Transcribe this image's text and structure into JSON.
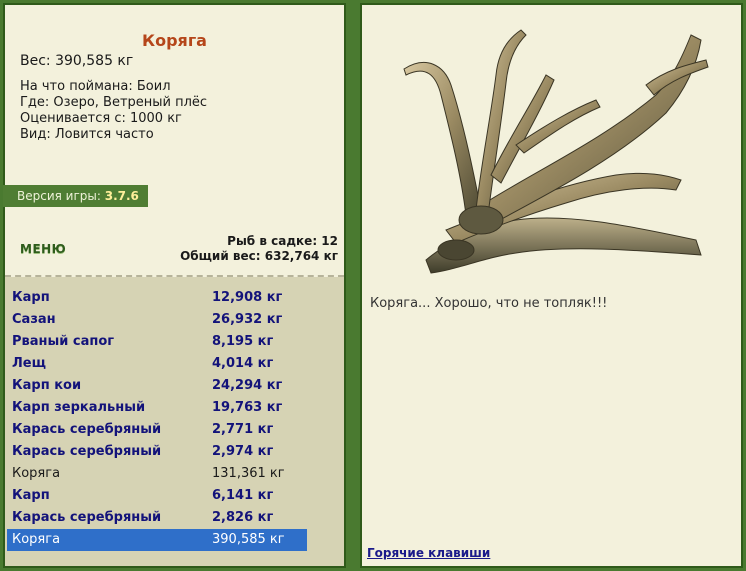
{
  "fish": {
    "name": "Коряга",
    "weight": "Вес: 390,585 кг",
    "caught_on": "На что поймана: Боил",
    "where": "Где: Озеро, Ветреный плёс",
    "valued_from": "Оценивается с: 1000 кг",
    "frequency": "Вид: Ловится часто"
  },
  "version": {
    "label": "Версия игры:",
    "value": "3.7.6"
  },
  "menu_label": "МЕНЮ",
  "cage": {
    "fish_count": "Рыб в садке: 12",
    "total_weight": "Общий вес: 632,764 кг"
  },
  "catch_list": [
    {
      "name": "Карп",
      "weight": "12,908 кг",
      "style": "b"
    },
    {
      "name": "Сазан",
      "weight": "26,932 кг",
      "style": "b"
    },
    {
      "name": "Рваный сапог",
      "weight": "8,195 кг",
      "style": "b"
    },
    {
      "name": "Лещ",
      "weight": "4,014 кг",
      "style": "b"
    },
    {
      "name": "Карп кои",
      "weight": "24,294 кг",
      "style": "b"
    },
    {
      "name": "Карп зеркальный",
      "weight": "19,763 кг",
      "style": "b"
    },
    {
      "name": "Карась серебряный",
      "weight": "2,771 кг",
      "style": "b"
    },
    {
      "name": "Карась серебряный",
      "weight": "2,974 кг",
      "style": "b"
    },
    {
      "name": "Коряга",
      "weight": "131,361 кг",
      "style": "n"
    },
    {
      "name": "Карп",
      "weight": "6,141 кг",
      "style": "b"
    },
    {
      "name": "Карась серебряный",
      "weight": "2,826 кг",
      "style": "b"
    },
    {
      "name": "Коряга",
      "weight": "390,585 кг",
      "style": "sel"
    }
  ],
  "detail_caption": "Коряга... Хорошо, что не топляк!!!",
  "hotkeys_label": "Горячие клавиши",
  "colors": {
    "accent_title": "#b5461a",
    "selection": "#2f6fc9",
    "frame": "#4a7a30"
  }
}
